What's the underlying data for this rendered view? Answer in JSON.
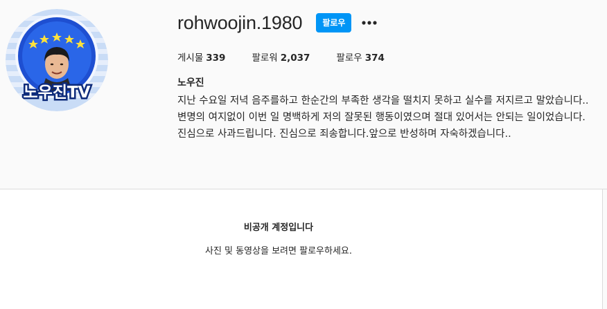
{
  "profile": {
    "avatar_text": "노우진TV",
    "username": "rohwoojin.1980",
    "follow_label": "팔로우",
    "more_icon": "more-dots-icon",
    "stats": [
      {
        "label": "게시물",
        "value": "339"
      },
      {
        "label": "팔로워",
        "value": "2,037"
      },
      {
        "label": "팔로우",
        "value": "374"
      }
    ],
    "full_name": "노우진",
    "bio": "지난 수요일 저녁 음주를하고 한순간의 부족한 생각을 떨치지 못하고 실수를 저지르고 말았습니다..변명의 여지없이 이번 일 명백하게 저의 잘못된 행동이였으며 절대 있어서는 안되는 일이었습니다. 진심으로 사과드립니다. 진심으로 죄송합니다.앞으로 반성하며 자숙하겠습니다.."
  },
  "private_notice": {
    "title": "비공개 계정입니다",
    "description": "사진 및 동영상을 보려면 팔로우하세요."
  },
  "colors": {
    "accent": "#0095f6",
    "page_bg": "#fafafa",
    "border": "#dbdbdb",
    "text": "#262626"
  }
}
